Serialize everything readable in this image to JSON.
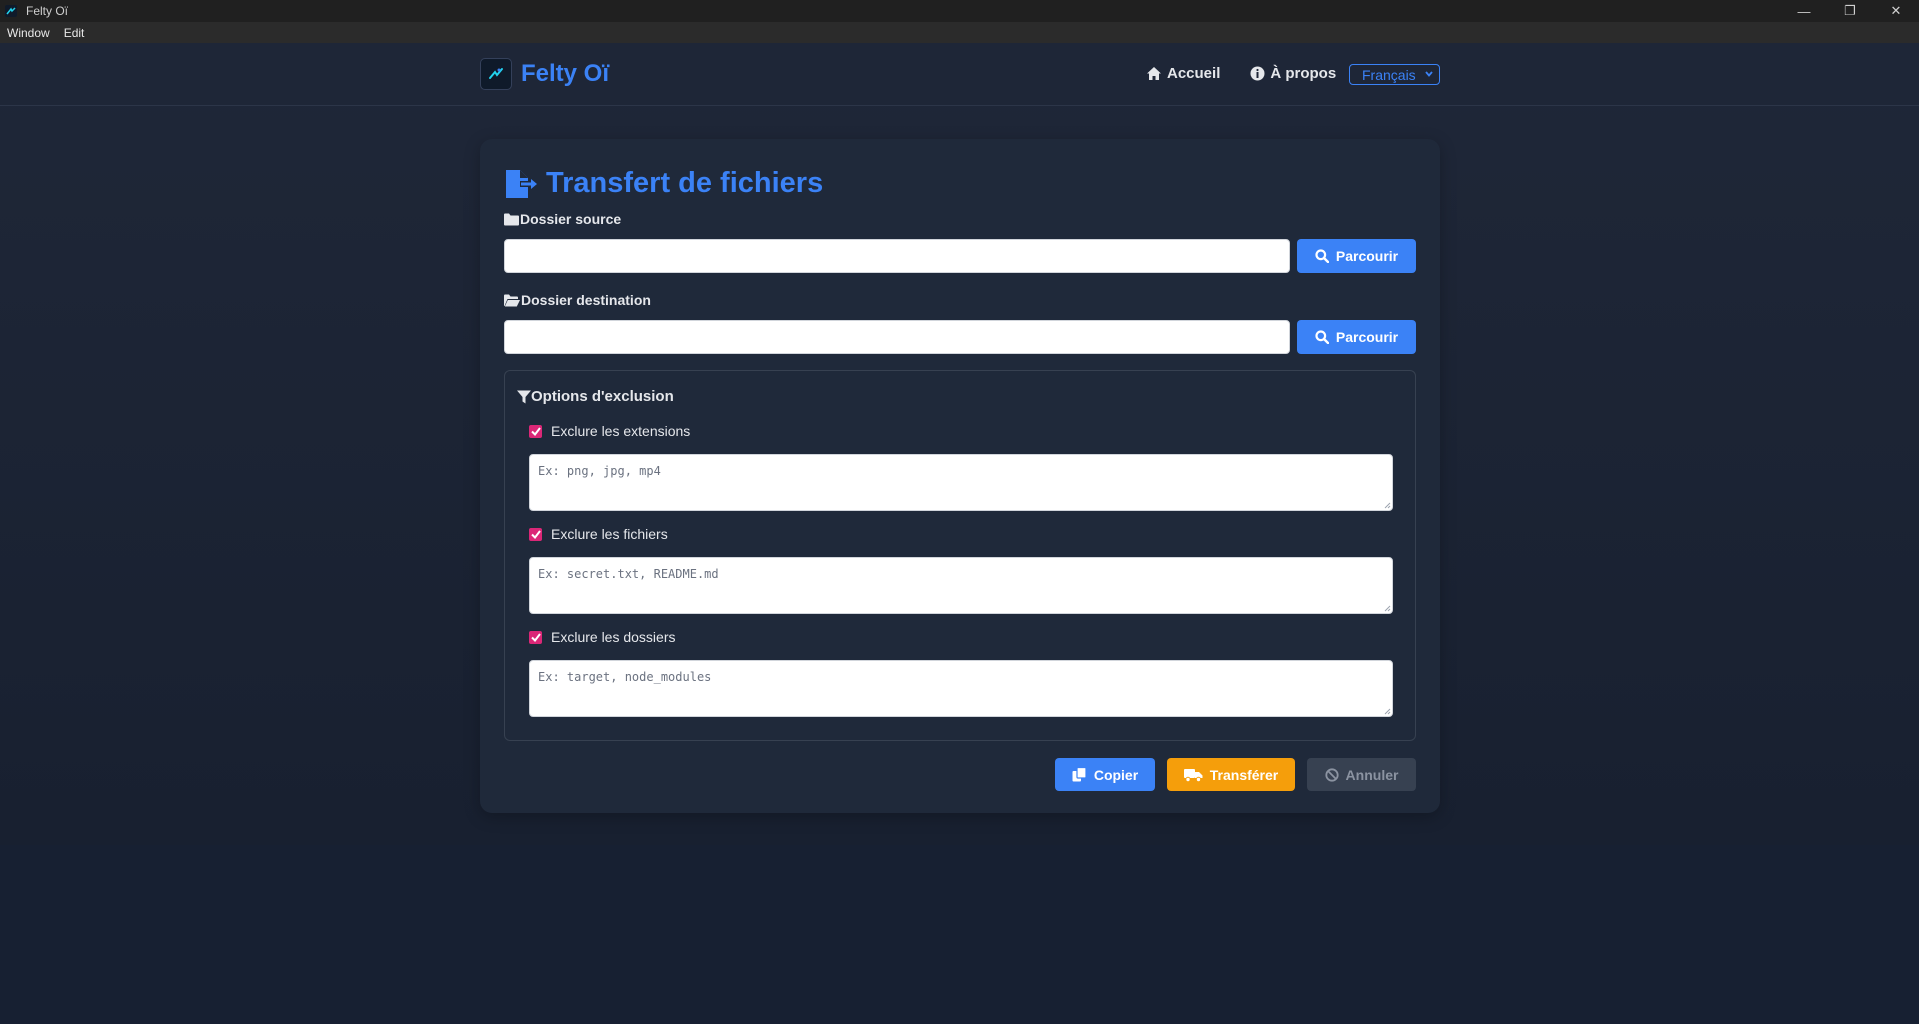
{
  "window": {
    "title": "Felty Oï",
    "controls": {
      "minimize": "—",
      "restore": "❐",
      "close": "✕"
    }
  },
  "menubar": {
    "items": [
      "Window",
      "Edit"
    ]
  },
  "header": {
    "brand": "Felty Oï",
    "nav": {
      "home": "Accueil",
      "about": "À propos"
    },
    "language": "Français"
  },
  "transfer": {
    "title": "Transfert de fichiers",
    "source_label": "Dossier source",
    "source_value": "",
    "destination_label": "Dossier destination",
    "destination_value": "",
    "browse_label": "Parcourir",
    "exclusion": {
      "title": "Options d'exclusion",
      "extensions": {
        "label": "Exclure les extensions",
        "checked": true,
        "placeholder": "Ex: png, jpg, mp4",
        "value": ""
      },
      "files": {
        "label": "Exclure les fichiers",
        "checked": true,
        "placeholder": "Ex: secret.txt, README.md",
        "value": ""
      },
      "folders": {
        "label": "Exclure les dossiers",
        "checked": true,
        "placeholder": "Ex: target, node_modules",
        "value": ""
      }
    },
    "actions": {
      "copy": "Copier",
      "transfer": "Transférer",
      "cancel": "Annuler"
    }
  },
  "colors": {
    "accent": "#3b82f6",
    "transfer_button": "#f59e0b",
    "checkbox": "#db2777",
    "card": "#1f293a",
    "disabled": "#374151"
  }
}
